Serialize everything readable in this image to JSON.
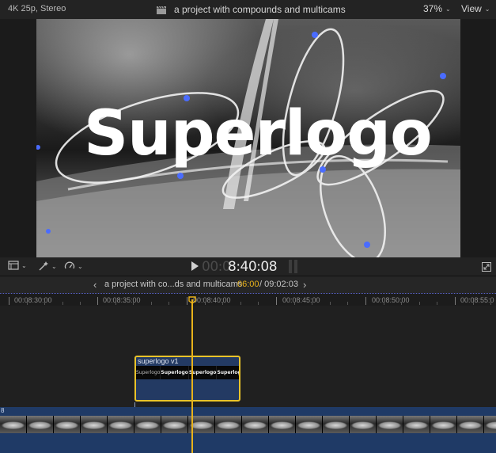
{
  "header": {
    "format": "4K 25p, Stereo",
    "project_title": "a project with compounds and multicams",
    "zoom": "37%",
    "view_menu": "View"
  },
  "viewer": {
    "title_text": "Superlogo"
  },
  "controls": {
    "timecode_dim": "00:0",
    "timecode_bright": "8:40:08"
  },
  "timeline_nav": {
    "project": "a project with co...ds and multicams",
    "current_time": "06:00",
    "separator": "/",
    "total_time": "09:02:03"
  },
  "ruler": {
    "ticks": [
      "00:08:30:00",
      "00:08:35:00",
      "00:08:40:00",
      "00:08:45:00",
      "00:08:50:00",
      "00:08:55:0"
    ]
  },
  "connected_clip": {
    "name": "superlogo v1",
    "thumbnails": [
      "Superlogo",
      "Superlogo",
      "Superlogo",
      "Superlogo"
    ]
  },
  "primary_clip": {
    "label": "8"
  },
  "colors": {
    "playhead": "#e9b21a",
    "selection": "#e9c32a",
    "clip_blue": "#1f3a66"
  }
}
